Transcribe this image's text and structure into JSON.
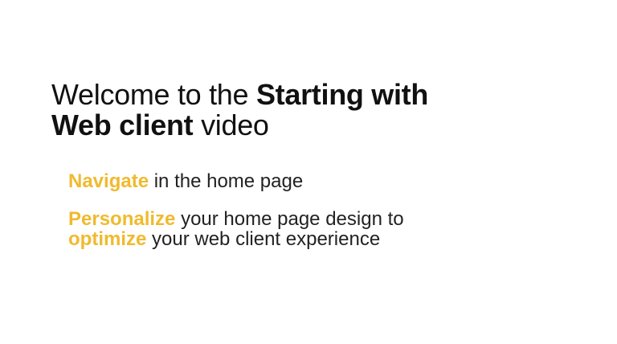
{
  "colors": {
    "accent": "#f0ba2e",
    "text": "#111111",
    "background": "#ffffff"
  },
  "title": {
    "prefix": "Welcome to the ",
    "bold_line1": "Starting with",
    "bold_line2": "Web client",
    "suffix": " video"
  },
  "bullets": [
    {
      "accent": "Navigate",
      "text": " in the home page"
    },
    {
      "accent1": "Personalize",
      "text1": " your home page design to",
      "accent2": "optimize",
      "text2": " your web client experience"
    }
  ]
}
